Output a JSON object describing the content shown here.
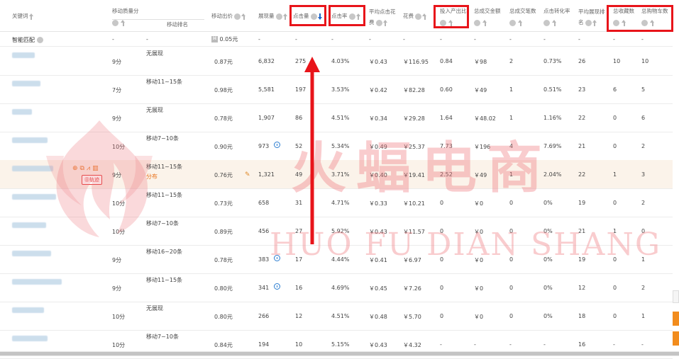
{
  "headers": {
    "keyword": "关键词",
    "quality": "移动质量分",
    "rank": "移动排名",
    "bid": "移动出价",
    "impressions": "展现量",
    "clicks": "点击量",
    "ctr": "点击率",
    "avg_cpc": "平均点击花费",
    "cost": "花费",
    "roi": "投入产出比",
    "gmv": "总成交金额",
    "orders": "总成交笔数",
    "cvr": "点击转化率",
    "avg_rank": "平均展现排名",
    "favorites": "总收藏数",
    "cart": "总购物车数"
  },
  "smart": {
    "label": "智能匹配",
    "quality": "-",
    "rank": "-",
    "bid": "0.05元",
    "impressions": "-",
    "clicks": "-",
    "ctr": "-",
    "avg_cpc": "-",
    "cost": "-",
    "roi": "-",
    "gmv": "-",
    "orders": "-",
    "cvr": "-",
    "avg_rank": "-",
    "favorites": "-",
    "cart": "-"
  },
  "rows": [
    {
      "quality": "9分",
      "rank": "无展现",
      "rank_sub": "",
      "bid": "0.87元",
      "impressions": "6,832",
      "clicks": "275",
      "ctr": "4.03%",
      "avg_cpc": "￥0.43",
      "cost": "￥116.95",
      "roi": "0.84",
      "gmv": "￥98",
      "orders": "2",
      "cvr": "0.73%",
      "avg_rank": "26",
      "favorites": "10",
      "cart": "10"
    },
    {
      "quality": "7分",
      "rank": "移动11~15条",
      "rank_sub": "",
      "bid": "0.98元",
      "impressions": "5,581",
      "clicks": "197",
      "ctr": "3.53%",
      "avg_cpc": "￥0.42",
      "cost": "￥82.28",
      "roi": "0.60",
      "gmv": "￥49",
      "orders": "1",
      "cvr": "0.51%",
      "avg_rank": "23",
      "favorites": "6",
      "cart": "5"
    },
    {
      "quality": "9分",
      "rank": "无展现",
      "rank_sub": "",
      "bid": "0.78元",
      "impressions": "1,907",
      "clicks": "86",
      "ctr": "4.51%",
      "avg_cpc": "￥0.34",
      "cost": "￥29.28",
      "roi": "1.64",
      "gmv": "￥48.02",
      "orders": "1",
      "cvr": "1.16%",
      "avg_rank": "22",
      "favorites": "0",
      "cart": "6"
    },
    {
      "quality": "10分",
      "rank": "移动7~10条",
      "rank_sub": "",
      "bid": "0.90元",
      "impressions": "973",
      "clicks": "52",
      "ctr": "5.34%",
      "avg_cpc": "￥0.49",
      "cost": "￥25.37",
      "roi": "7.73",
      "gmv": "￥196",
      "orders": "4",
      "cvr": "7.69%",
      "avg_rank": "21",
      "favorites": "0",
      "cart": "2"
    },
    {
      "quality": "9分",
      "rank": "移动11~15条",
      "rank_sub": "分布",
      "bid": "0.76元",
      "impressions": "1,321",
      "clicks": "49",
      "ctr": "3.71%",
      "avg_cpc": "￥0.40",
      "cost": "￥19.41",
      "roi": "2.52",
      "gmv": "￥49",
      "orders": "1",
      "cvr": "2.04%",
      "avg_rank": "22",
      "favorites": "1",
      "cart": "3"
    },
    {
      "quality": "10分",
      "rank": "移动11~15条",
      "rank_sub": "",
      "bid": "0.73元",
      "impressions": "658",
      "clicks": "31",
      "ctr": "4.71%",
      "avg_cpc": "￥0.33",
      "cost": "￥10.21",
      "roi": "0",
      "gmv": "￥0",
      "orders": "0",
      "cvr": "0%",
      "avg_rank": "19",
      "favorites": "0",
      "cart": "2"
    },
    {
      "quality": "10分",
      "rank": "移动7~10条",
      "rank_sub": "",
      "bid": "0.89元",
      "impressions": "456",
      "clicks": "27",
      "ctr": "5.92%",
      "avg_cpc": "￥0.43",
      "cost": "￥11.57",
      "roi": "0",
      "gmv": "￥0",
      "orders": "0",
      "cvr": "0%",
      "avg_rank": "21",
      "favorites": "1",
      "cart": "0"
    },
    {
      "quality": "9分",
      "rank": "移动16~20条",
      "rank_sub": "",
      "bid": "0.78元",
      "impressions": "383",
      "clicks": "17",
      "ctr": "4.44%",
      "avg_cpc": "￥0.41",
      "cost": "￥6.97",
      "roi": "0",
      "gmv": "￥0",
      "orders": "0",
      "cvr": "0%",
      "avg_rank": "19",
      "favorites": "0",
      "cart": "1"
    },
    {
      "quality": "9分",
      "rank": "移动11~15条",
      "rank_sub": "",
      "bid": "0.80元",
      "impressions": "341",
      "clicks": "16",
      "ctr": "4.69%",
      "avg_cpc": "￥0.45",
      "cost": "￥7.26",
      "roi": "0",
      "gmv": "￥0",
      "orders": "0",
      "cvr": "0%",
      "avg_rank": "12",
      "favorites": "0",
      "cart": "2"
    },
    {
      "quality": "10分",
      "rank": "无展现",
      "rank_sub": "",
      "bid": "0.80元",
      "impressions": "266",
      "clicks": "12",
      "ctr": "4.51%",
      "avg_cpc": "￥0.48",
      "cost": "￥5.70",
      "roi": "0",
      "gmv": "￥0",
      "orders": "0",
      "cvr": "0%",
      "avg_rank": "18",
      "favorites": "0",
      "cart": "1"
    },
    {
      "quality": "10分",
      "rank": "移动7~10条",
      "rank_sub": "",
      "bid": "0.84元",
      "impressions": "194",
      "clicks": "10",
      "ctr": "5.15%",
      "avg_cpc": "￥0.43",
      "cost": "￥4.32",
      "roi": "-",
      "gmv": "-",
      "orders": "-",
      "cvr": "-",
      "avg_rank": "16",
      "favorites": "-",
      "cart": "-"
    }
  ],
  "badge": "㊐轨迹",
  "watermark": {
    "cn": "火蝠电商",
    "en": "HUO FU DIAN SHANG"
  },
  "colors": {
    "highlight_box": "#e8141a",
    "sort_active": "#1e64c8",
    "accent_orange": "#f28c1d"
  }
}
